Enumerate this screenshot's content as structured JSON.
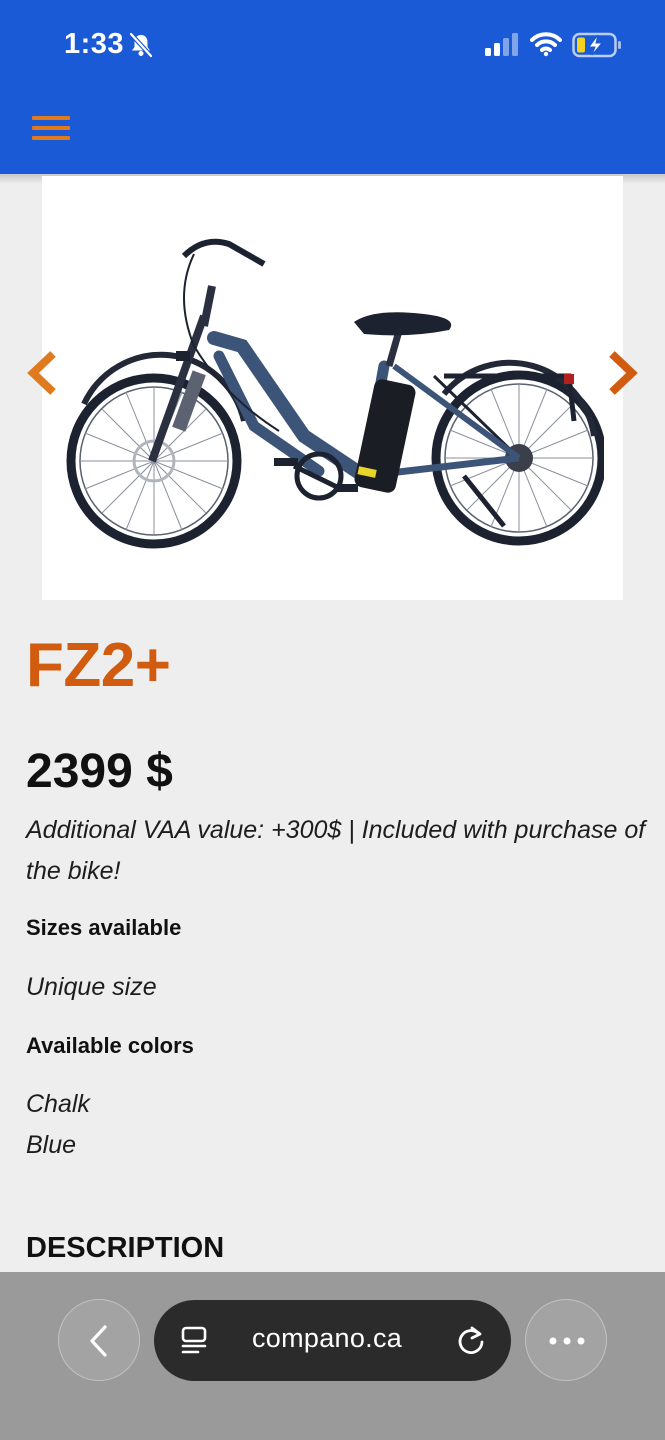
{
  "status_bar": {
    "time": "1:33"
  },
  "product": {
    "name": "FZ2+",
    "price": "2399 $",
    "vaa_note": "Additional VAA value: +300$ | Included with purchase of the bike!",
    "sizes_label": "Sizes available",
    "size_value": "Unique size",
    "colors_label": "Available colors",
    "colors": [
      "Chalk",
      "Blue"
    ],
    "description_heading": "DESCRIPTION"
  },
  "browser": {
    "url": "compano.ca"
  },
  "colors": {
    "header_blue": "#1a5ad6",
    "accent_orange": "#d15b0e",
    "menu_orange": "#e07a1f",
    "page_bg": "#eeeeee",
    "browser_bar": "#9a9a9a"
  },
  "icons": [
    "bell-off-icon",
    "signal-icon",
    "wifi-icon",
    "battery-charging-icon",
    "hamburger-menu-icon",
    "chevron-left-icon",
    "chevron-right-icon",
    "back-icon",
    "tab-icon",
    "reload-icon",
    "more-icon"
  ]
}
